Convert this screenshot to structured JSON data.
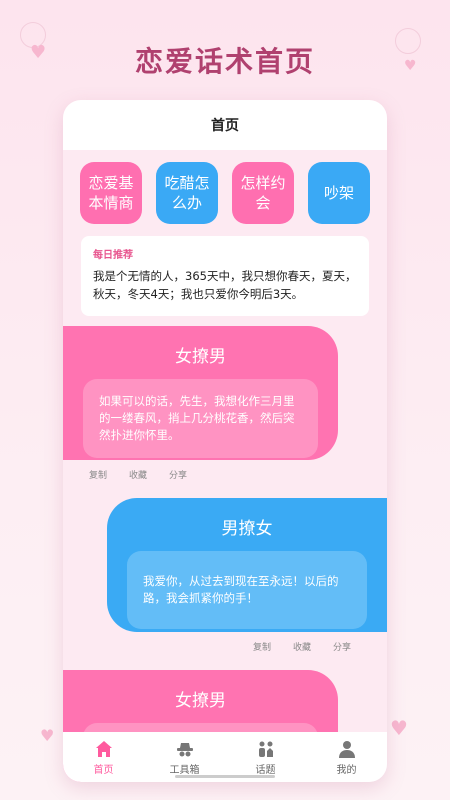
{
  "app": {
    "title": "恋爱话术首页"
  },
  "header": {
    "title": "首页"
  },
  "categories": [
    {
      "label": "恋爱基本情商",
      "color": "#ff6fb0"
    },
    {
      "label": "吃醋怎么办",
      "color": "#3aa9f5"
    },
    {
      "label": "怎样约会",
      "color": "#ff6fb0"
    },
    {
      "label": "吵架",
      "color": "#3aa9f5"
    }
  ],
  "daily": {
    "label": "每日推荐",
    "text": "我是个无情的人，365天中，我只想你春天，夏天，秋天，冬天4天；我也只爱你今明后3天。"
  },
  "cards": [
    {
      "title": "女撩男",
      "text": "如果可以的话，先生，我想化作三月里的一缕春风，捎上几分桃花香，然后突然扑进你怀里。"
    },
    {
      "title": "男撩女",
      "text": "我爱你，从过去到现在至永远！以后的路，我会抓紧你的手！"
    },
    {
      "title": "女撩男",
      "text": ""
    }
  ],
  "actions": {
    "copy": "复制",
    "favorite": "收藏",
    "share": "分享"
  },
  "tabs": [
    {
      "label": "首页",
      "icon": "home-icon",
      "active": true
    },
    {
      "label": "工具箱",
      "icon": "toolbox-icon",
      "active": false
    },
    {
      "label": "话题",
      "icon": "topic-icon",
      "active": false
    },
    {
      "label": "我的",
      "icon": "profile-icon",
      "active": false
    }
  ],
  "colors": {
    "accent": "#ff5a9e",
    "title": "#b0416f",
    "pink": "#ff73b1",
    "blue": "#3aaaf4"
  }
}
